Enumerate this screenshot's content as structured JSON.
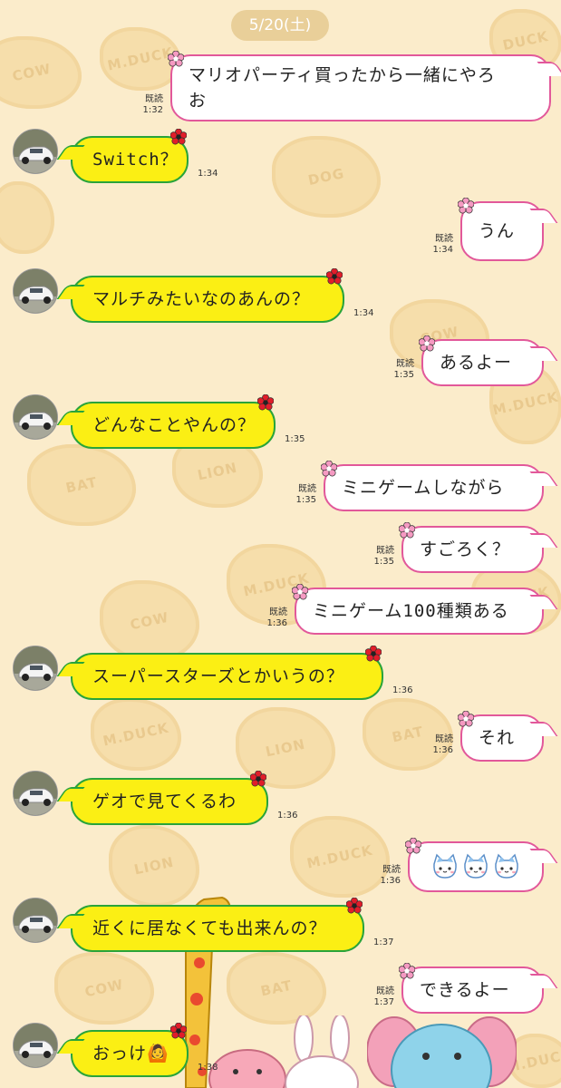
{
  "date_label": "5/20(土)",
  "read_label": "既読",
  "messages": [
    {
      "side": "me",
      "text": "マリオパーティ買ったから一緒にやろ\nお",
      "time": "1:32",
      "read": true
    },
    {
      "side": "them",
      "text": "Switch？",
      "time": "1:34"
    },
    {
      "side": "me",
      "text": "うん",
      "time": "1:34",
      "read": true
    },
    {
      "side": "them",
      "text": "マルチみたいなのあんの？",
      "time": "1:34"
    },
    {
      "side": "me",
      "text": "あるよー",
      "time": "1:35",
      "read": true
    },
    {
      "side": "them",
      "text": "どんなことやんの？",
      "time": "1:35"
    },
    {
      "side": "me",
      "text": "ミニゲームしながら",
      "time": "1:35",
      "read": true
    },
    {
      "side": "me",
      "text": "すごろく？",
      "time": "1:35",
      "read": true
    },
    {
      "side": "me",
      "text": "ミニゲーム100種類ある",
      "time": "1:36",
      "read": true
    },
    {
      "side": "them",
      "text": "スーパースターズとかいうの？",
      "time": "1:36"
    },
    {
      "side": "me",
      "text": "それ",
      "time": "1:36",
      "read": true
    },
    {
      "side": "them",
      "text": "ゲオで見てくるわ",
      "time": "1:36"
    },
    {
      "side": "me",
      "text": "",
      "time": "1:36",
      "read": true,
      "emoji": "cat-face-stickers"
    },
    {
      "side": "them",
      "text": "近くに居なくても出来んの？",
      "time": "1:37"
    },
    {
      "side": "me",
      "text": "できるよー",
      "time": "1:37",
      "read": true
    },
    {
      "side": "them",
      "text": "おっけ🙆",
      "time": "1:38"
    }
  ],
  "colors": {
    "background": "#fbeccb",
    "my_bubble_border": "#e2589a",
    "their_bubble_fill": "#fbef14",
    "their_bubble_border": "#29a43a"
  }
}
